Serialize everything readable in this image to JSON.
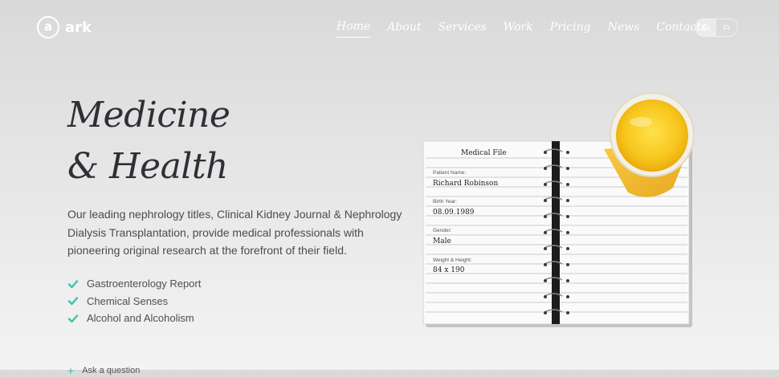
{
  "brand": {
    "logo_letter": "a",
    "name": "ark"
  },
  "nav": {
    "items": [
      "Home",
      "About",
      "Services",
      "Work",
      "Pricing",
      "News",
      "Contacts"
    ],
    "active": "Home"
  },
  "language": {
    "options": [
      "En",
      "Fr"
    ],
    "selected": "En"
  },
  "hero": {
    "title_line1": "Medicine",
    "title_line2": "& Health",
    "description": "Our leading nephrology titles, Clinical Kidney Journal & Nephrology Dialysis Transplantation, provide medical professionals with pioneering original research at the forefront of their field.",
    "features": [
      "Gastroenterology Report",
      "Chemical Senses",
      "Alcohol and Alcoholism"
    ],
    "cta": "Ask a question",
    "accent_color": "#3fc1ad"
  },
  "notebook": {
    "heading": "Medical File",
    "fields": [
      {
        "label": "Patient Name:",
        "value": "Richard Robinson"
      },
      {
        "label": "Birth Year:",
        "value": "08.09.1989"
      },
      {
        "label": "Gender:",
        "value": "Male"
      },
      {
        "label": "Weight & Height:",
        "value": "84 x 190"
      }
    ]
  },
  "icons": {
    "feature_bullet": "check-icon",
    "cta": "plus-icon"
  }
}
